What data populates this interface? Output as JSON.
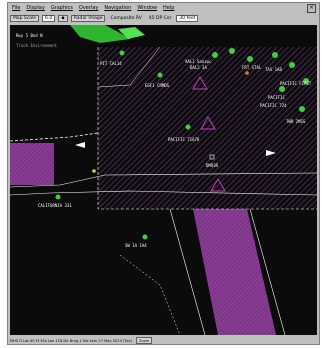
{
  "menu": {
    "items": [
      "File",
      "Display",
      "Graphics",
      "Overlay",
      "Navigation",
      "Window",
      "Help"
    ]
  },
  "toolbar": {
    "map_scale_label": "Map Scale",
    "scale_value": "6.0",
    "radar_image_label": "Radar Image",
    "readout_1": "Composite RV",
    "readout_2": "45 DP Cor",
    "readout_3": "30 feet"
  },
  "map": {
    "corner_label": "Rwy 5 Bnd N",
    "top_left_label": "Track Environment",
    "aircraft": [
      {
        "id": "aal1",
        "label": "PIT CAL14"
      },
      {
        "id": "aal2",
        "label": "DAL2 3A"
      },
      {
        "id": "aal3",
        "label": "AAL1 Sonzwc"
      },
      {
        "id": "aal4",
        "label": "EGF1 CRMDS"
      },
      {
        "id": "aal5",
        "label": "FRT STAL"
      },
      {
        "id": "aal6",
        "label": "TAX 1AB"
      },
      {
        "id": "aal7",
        "label": "PACIFIC FIRST"
      },
      {
        "id": "aal8",
        "label": "PACIFIC"
      },
      {
        "id": "aal9",
        "label": "PACIFIC 724"
      },
      {
        "id": "aal10",
        "label": "TWR 2MSS"
      },
      {
        "id": "aal11",
        "label": "PACIFIC 71678"
      },
      {
        "id": "aal12",
        "label": "DMO3R"
      },
      {
        "id": "aal13",
        "label": "CALIFORNIA 331"
      },
      {
        "id": "aal14",
        "label": "SW 1A 1A4"
      }
    ]
  },
  "status": {
    "text": "MHS G  Lat 40 Ft 35s  Lon 118 Dir  Brng 1 Sle 4km     27 May 2014 (Tue)",
    "zoom_label": "Zoom"
  },
  "colors": {
    "background": "#0b0b0b",
    "green": "#3bd23b",
    "purple": "#8a3a96",
    "hatch": "#7a3f86",
    "white": "#ffffff",
    "orange": "#e07c1c"
  }
}
